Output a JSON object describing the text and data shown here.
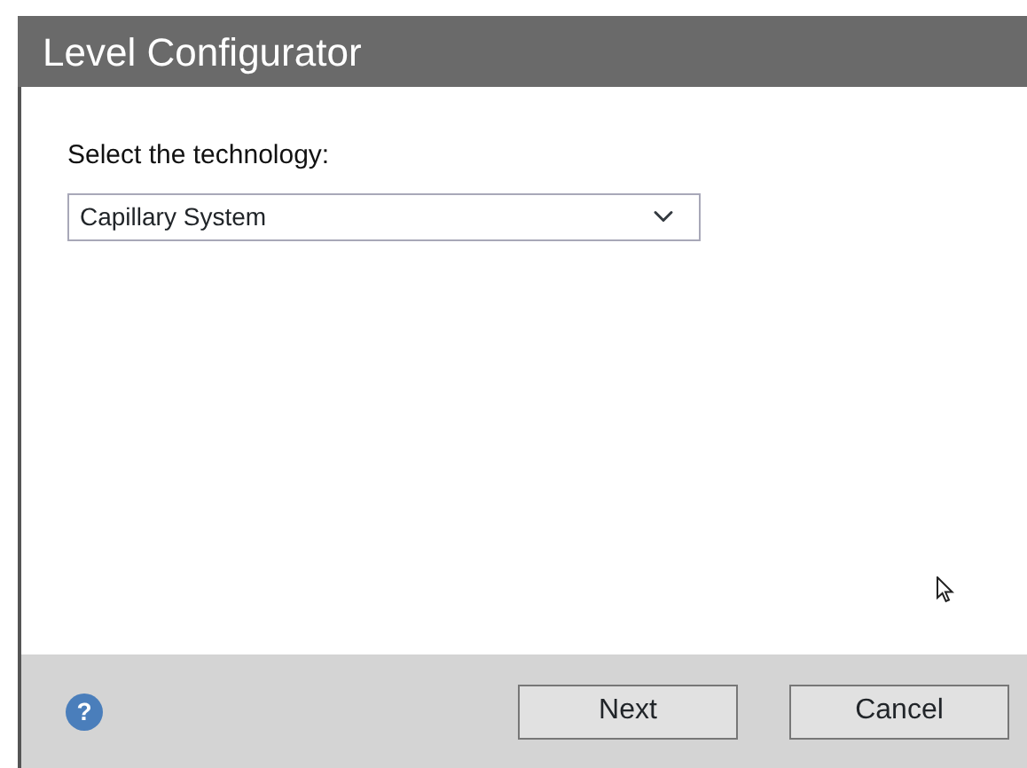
{
  "window": {
    "title": "Level Configurator"
  },
  "technology": {
    "label": "Select the technology:",
    "value": "Capillary System"
  },
  "footer": {
    "help": "?",
    "buttons": [
      {
        "label": "Next"
      },
      {
        "label": "Cancel"
      }
    ]
  }
}
